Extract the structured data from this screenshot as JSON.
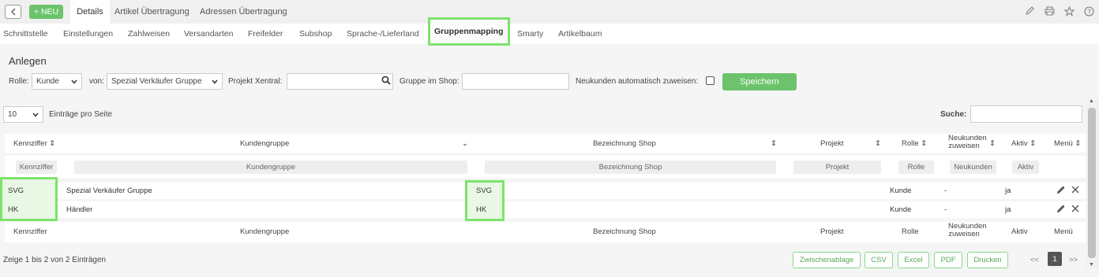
{
  "topbar": {
    "new_label": "+ NEU",
    "tabs": [
      "Details",
      "Artikel Übertragung",
      "Adressen Übertragung"
    ]
  },
  "subnav": {
    "tabs": [
      "Schnittstelle",
      "Einstellungen",
      "Zahlweisen",
      "Versandarten",
      "Freifelder",
      "Subshop",
      "Sprache-/Lieferland",
      "Gruppenmapping",
      "Smarty",
      "Artikelbaum"
    ],
    "active": "Gruppenmapping"
  },
  "form": {
    "title": "Anlegen",
    "role_label": "Rolle:",
    "role_value": "Kunde",
    "from_label": "von:",
    "from_value": "Spezial Verkäufer Gruppe",
    "project_label": "Projekt Xentral:",
    "group_label": "Gruppe im Shop:",
    "auto_label": "Neukunden automatisch zuweisen:",
    "save_label": "Speichern"
  },
  "table": {
    "length_value": "10",
    "length_label": "Einträge pro Seite",
    "search_label": "Suche:",
    "headers": {
      "code": "Kennziffer",
      "group": "Kundengruppe",
      "shop": "Bezeichnung Shop",
      "project": "Projekt",
      "role": "Rolle",
      "new_line1": "Neukunden",
      "new_line2": "zuweisen",
      "active": "Aktiv",
      "menu": "Menü"
    },
    "filters": {
      "code": "Kennziffer",
      "group": "Kundengruppe",
      "shop": "Bezeichnung Shop",
      "project": "Projekt",
      "role": "Rolle",
      "new": "Neukunden",
      "active": "Aktiv"
    },
    "rows": [
      {
        "code": "SVG",
        "group": "Spezial Verkäufer Gruppe",
        "shop": "SVG",
        "role": "Kunde",
        "new": "-",
        "active": "ja"
      },
      {
        "code": "HK",
        "group": "Händler",
        "shop": "HK",
        "role": "Kunde",
        "new": "-",
        "active": "ja"
      }
    ],
    "info": "Zeige 1 bis 2 von 2 Einträgen",
    "export_buttons": [
      "Zwischenablage",
      "CSV",
      "Excel",
      "PDF",
      "Drucken"
    ],
    "pager": {
      "prev": "<<",
      "page": "1",
      "next": ">>"
    }
  },
  "colors": {
    "accent": "#6cc36c",
    "highlight": "#7de36b"
  },
  "icons": [
    "chevron-left-icon",
    "pencil-icon",
    "print-icon",
    "star-icon",
    "help-icon",
    "search-icon",
    "chevron-down-icon",
    "sort-icon",
    "edit-icon",
    "close-icon"
  ]
}
